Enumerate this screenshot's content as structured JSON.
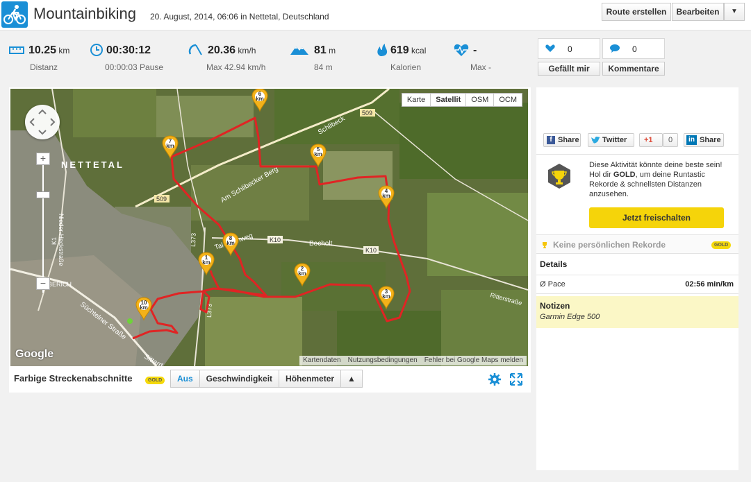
{
  "header": {
    "title": "Mountainbiking",
    "subtitle": "20. August, 2014, 06:06 in Nettetal, Deutschland",
    "route_button": "Route erstellen",
    "edit_button": "Bearbeiten",
    "menu_caret": "▼"
  },
  "stats": {
    "distance": {
      "value": "10.25",
      "unit": "km",
      "sub": "Distanz",
      "icon": "ruler-icon"
    },
    "duration": {
      "value": "00:30:12",
      "sub": "00:00:03 Pause",
      "icon": "clock-icon"
    },
    "speed": {
      "value": "20.36",
      "unit": "km/h",
      "sub": "Max 42.94 km/h",
      "icon": "speedometer-icon"
    },
    "elevation": {
      "value": "81",
      "unit": "m",
      "sub": "84 m",
      "icon": "mountain-icon"
    },
    "calories": {
      "value": "619",
      "unit": "kcal",
      "sub": "Kalorien",
      "icon": "flame-icon"
    },
    "heartrate": {
      "value": "-",
      "sub": "Max -",
      "icon": "heartbeat-icon"
    }
  },
  "social": {
    "likes": "0",
    "comments": "0",
    "like_label": "Gefällt mir",
    "comment_label": "Kommentare",
    "fb_share": "Share",
    "twitter": "Twitter",
    "gplus": "+1",
    "gplus_count": "0",
    "linkedin_share": "Share"
  },
  "map": {
    "types": [
      "Karte",
      "Satellit",
      "OSM",
      "OCM"
    ],
    "active_type": "Satellit",
    "town_label": "NETTETAL",
    "roads": [
      "Am Schlibecker Berg",
      "Schlibeck",
      "Tal-Kirchweg",
      "Bocholt",
      "K10",
      "K10",
      "L373",
      "L373",
      "509",
      "509",
      "K1",
      "Nieder-Heckstraße",
      "Süchtelner Straße",
      "Sittard",
      "BERICH",
      "Ritterstraße"
    ],
    "google": "Google",
    "attribution": [
      "Kartendaten",
      "Nutzungsbedingungen",
      "Fehler bei Google Maps melden"
    ],
    "markers": [
      "1",
      "2",
      "3",
      "4",
      "5",
      "6",
      "7",
      "8",
      "10"
    ],
    "marker_unit": "km",
    "route_color": "#e02424"
  },
  "segments": {
    "label": "Farbige Streckenabschnitte",
    "badge": "GOLD",
    "options": [
      "Aus",
      "Geschwindigkeit",
      "Höhenmeter"
    ],
    "active": "Aus",
    "caret": "▲"
  },
  "gold": {
    "text_before": "Diese Aktivität könnte deine beste sein! Hol dir ",
    "text_bold": "GOLD",
    "text_after": ", um deine Runtastic Rekorde & schnellsten Distanzen anzusehen.",
    "button": "Jetzt freischalten"
  },
  "records": {
    "text": "Keine persönlichen Rekorde",
    "badge": "GOLD"
  },
  "details": {
    "heading": "Details",
    "pace_label": "Ø Pace",
    "pace_value": "02:56 min/km"
  },
  "notes": {
    "heading": "Notizen",
    "value": "Garmin Edge 500"
  },
  "colors": {
    "brand_blue": "#1a8fd6",
    "gold": "#f5d40a",
    "notes_bg": "#fbf7c6"
  }
}
